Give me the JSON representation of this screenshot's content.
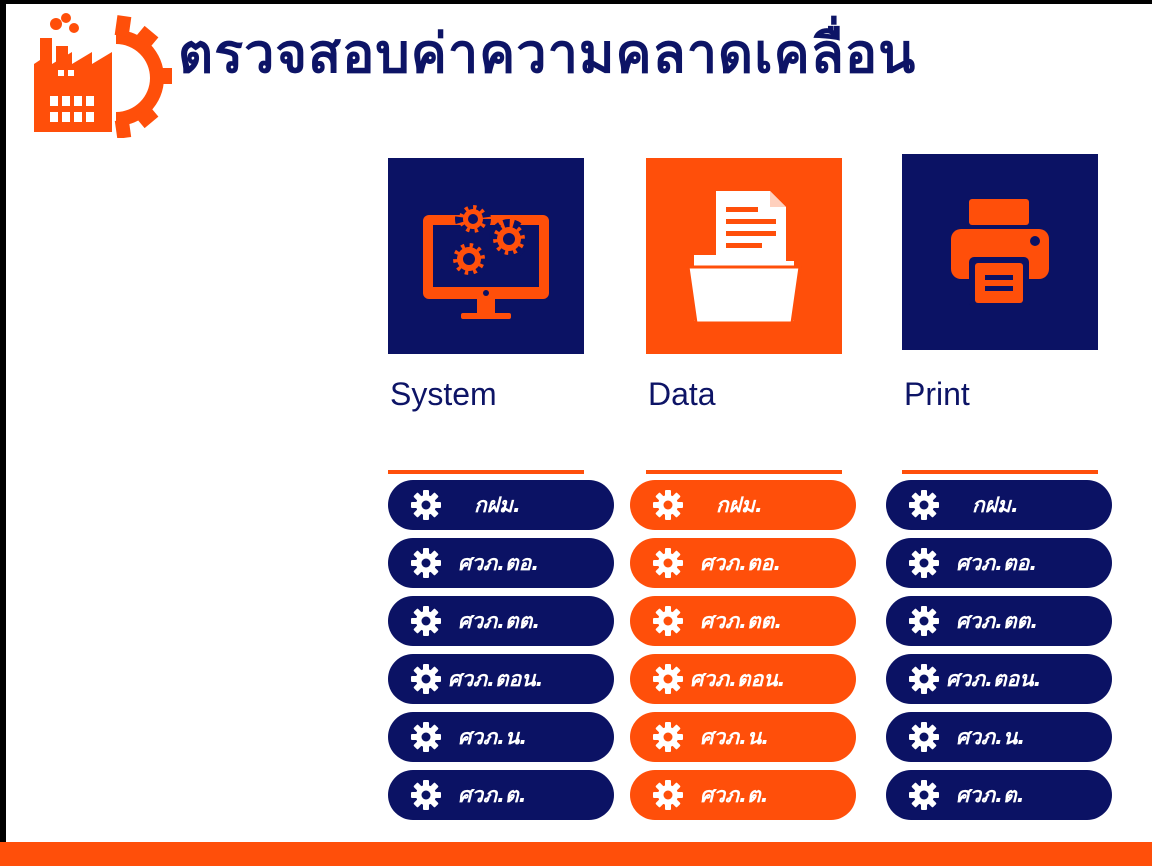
{
  "header": {
    "title": "ตรวจสอบค่าความคลาดเคลื่อน",
    "logo_icon": "factory-gear-icon"
  },
  "colors": {
    "navy": "#0b1264",
    "orange": "#ff4f0a",
    "frame": "#000000",
    "background": "#ffffff"
  },
  "columns": [
    {
      "label": "System",
      "icon": "computer-gears-icon",
      "card_color": "navy",
      "button_color": "navy",
      "buttons": [
        "กฝม.",
        "ศวภ.ตอ.",
        "ศวภ.ตต.",
        "ศวภ.ตอน.",
        "ศวภ.น.",
        "ศวภ.ต."
      ]
    },
    {
      "label": "Data",
      "icon": "folder-document-icon",
      "card_color": "orange",
      "button_color": "orange",
      "buttons": [
        "กฝม.",
        "ศวภ.ตอ.",
        "ศวภ.ตต.",
        "ศวภ.ตอน.",
        "ศวภ.น.",
        "ศวภ.ต."
      ]
    },
    {
      "label": "Print",
      "icon": "printer-icon",
      "card_color": "navy",
      "button_color": "navy",
      "buttons": [
        "กฝม.",
        "ศวภ.ตอ.",
        "ศวภ.ตต.",
        "ศวภ.ตอน.",
        "ศวภ.น.",
        "ศวภ.ต."
      ]
    }
  ]
}
